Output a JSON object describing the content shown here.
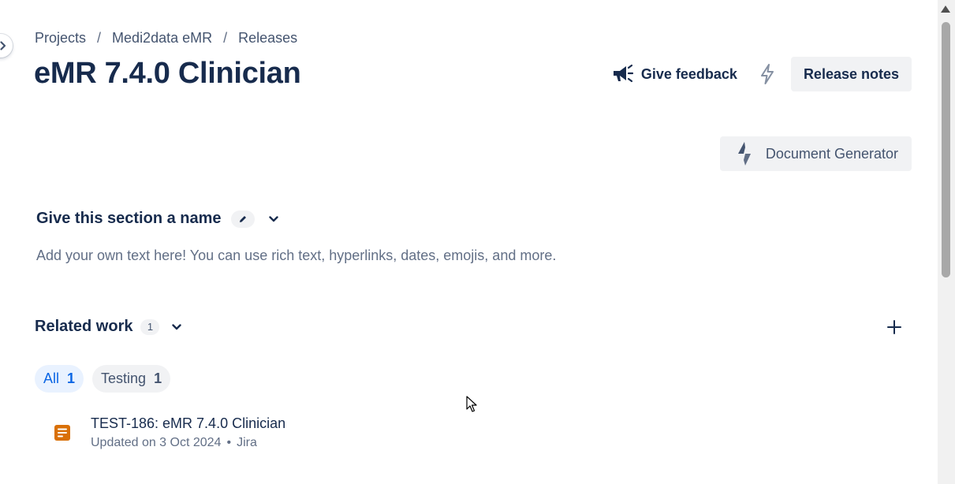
{
  "breadcrumb": {
    "items": [
      "Projects",
      "Medi2data eMR",
      "Releases"
    ],
    "separator": "/"
  },
  "page_title": "eMR 7.4.0 Clinician",
  "header_actions": {
    "feedback_label": "Give feedback",
    "release_notes_label": "Release notes"
  },
  "document_generator": {
    "label": "Document Generator"
  },
  "custom_section": {
    "title": "Give this section a name",
    "body": "Add your own text here! You can use rich text, hyperlinks, dates, emojis, and more."
  },
  "related_work": {
    "title": "Related work",
    "count": "1",
    "tabs": [
      {
        "label": "All",
        "count": "1",
        "active": true
      },
      {
        "label": "Testing",
        "count": "1",
        "active": false
      }
    ],
    "items": [
      {
        "title": "TEST-186: eMR 7.4.0 Clinician",
        "updated": "Updated on 3 Oct 2024",
        "source": "Jira",
        "icon": "page-icon"
      }
    ]
  },
  "colors": {
    "text_primary": "#172b4d",
    "text_subtle": "#44546f",
    "accent_blue": "#0c66e4",
    "icon_orange": "#d97008"
  }
}
